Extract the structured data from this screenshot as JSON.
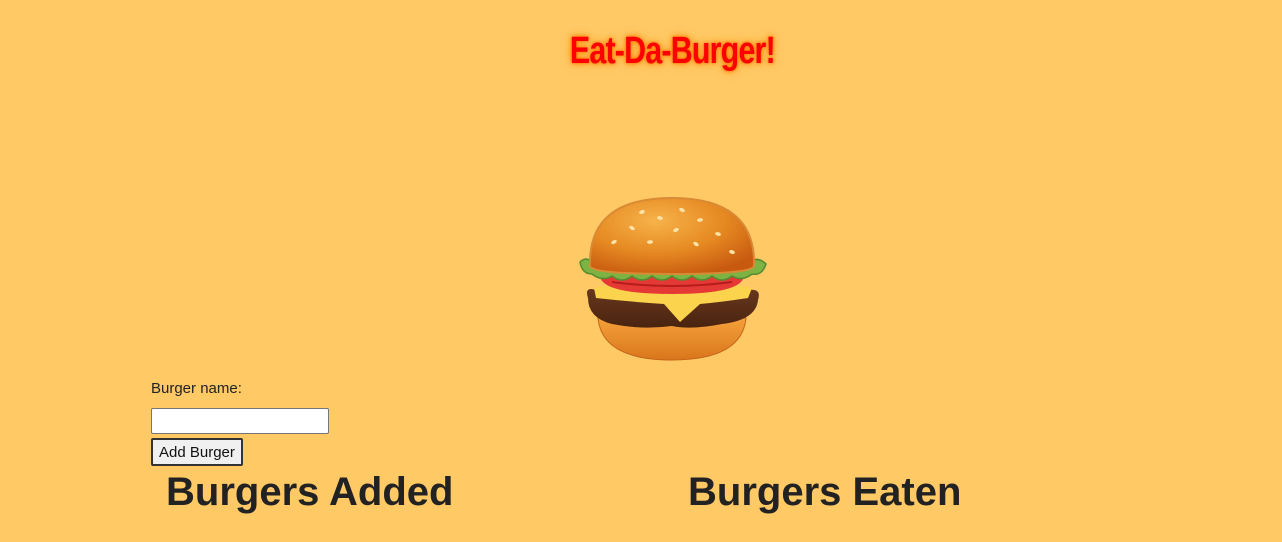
{
  "header": {
    "title": "Eat-Da-Burger!"
  },
  "hero": {
    "image_icon": "hamburger-icon"
  },
  "form": {
    "label": "Burger name:",
    "input_value": "",
    "input_placeholder": "",
    "submit_label": "Add Burger"
  },
  "columns": {
    "added_heading": "Burgers Added",
    "eaten_heading": "Burgers Eaten"
  },
  "colors": {
    "background": "#ffc966",
    "title": "#ff0000",
    "title_glow": "#ff8800",
    "text": "#222222"
  }
}
